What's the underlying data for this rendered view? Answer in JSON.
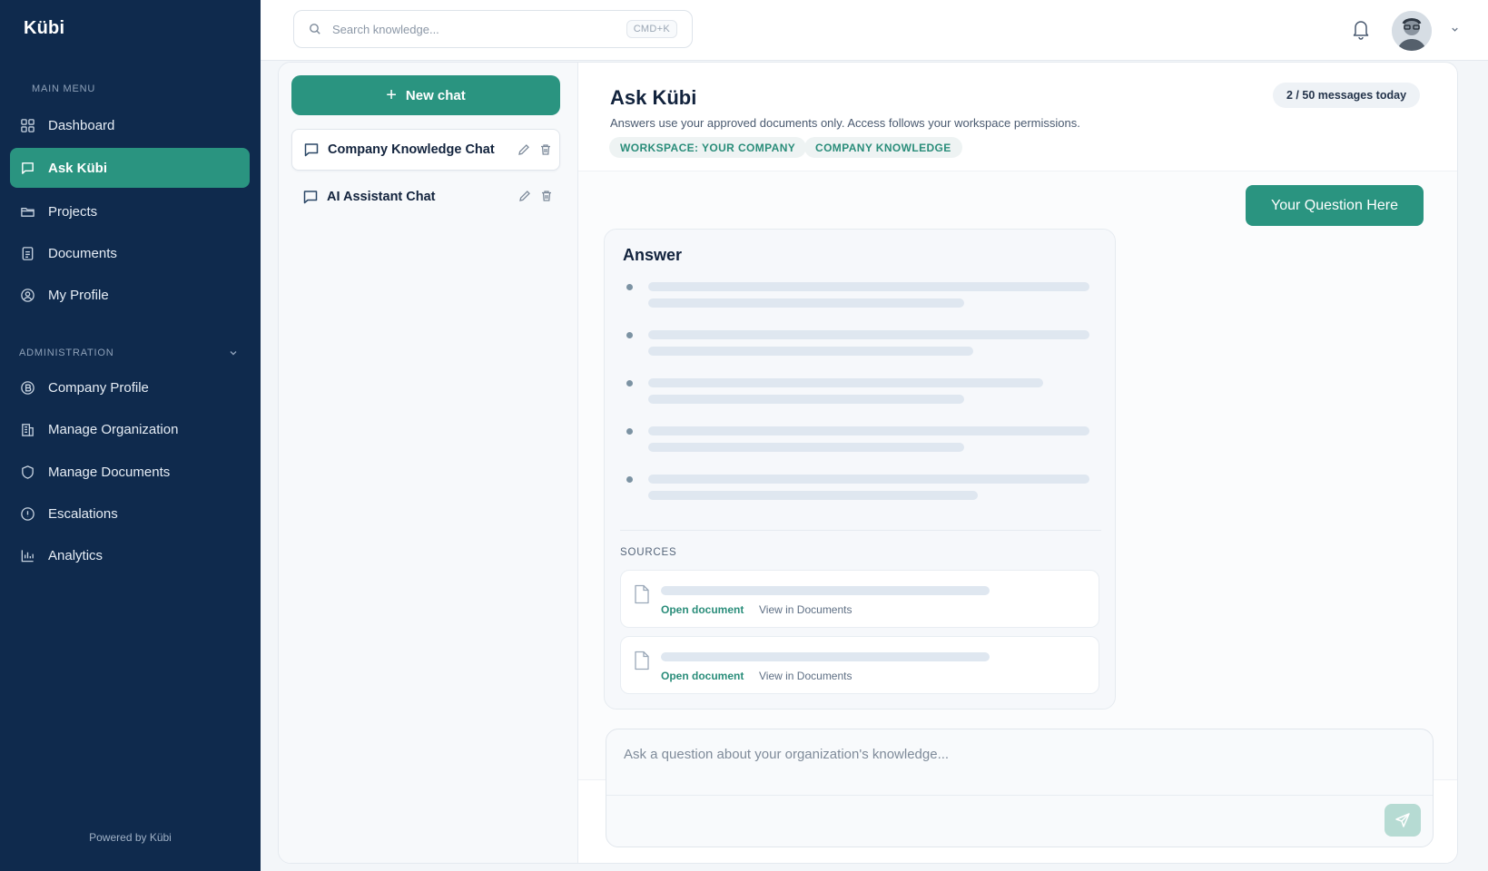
{
  "brand": {
    "name": "Kübi",
    "powered_by": "Powered by Kübi"
  },
  "sidebar": {
    "main_menu_label": "MAIN MENU",
    "admin_label": "ADMINISTRATION",
    "main_items": [
      {
        "label": "Dashboard",
        "icon": "dashboard-icon"
      },
      {
        "label": "Ask Kübi",
        "icon": "chat-icon",
        "active": true
      },
      {
        "label": "Projects",
        "icon": "folder-icon"
      },
      {
        "label": "Documents",
        "icon": "document-icon"
      },
      {
        "label": "My Profile",
        "icon": "profile-icon"
      }
    ],
    "admin_items": [
      {
        "label": "Company Profile",
        "icon": "company-icon"
      },
      {
        "label": "Manage Organization",
        "icon": "building-icon"
      },
      {
        "label": "Manage Documents",
        "icon": "shield-icon"
      },
      {
        "label": "Escalations",
        "icon": "alert-icon"
      },
      {
        "label": "Analytics",
        "icon": "analytics-icon"
      }
    ]
  },
  "topbar": {
    "search_placeholder": "Search knowledge...",
    "shortcut": "CMD+K"
  },
  "chats": {
    "new_chat_label": "New chat",
    "items": [
      {
        "title": "Company Knowledge Chat",
        "selected": true
      },
      {
        "title": "AI Assistant Chat",
        "selected": false
      }
    ]
  },
  "conversation": {
    "title": "Ask Kübi",
    "subtitle": "Answers use your approved documents only. Access follows your workspace permissions.",
    "tags": [
      "WORKSPACE: YOUR COMPANY",
      "COMPANY KNOWLEDGE"
    ],
    "quota": "2 / 50 messages today",
    "question": "Your Question Here",
    "answer_title": "Answer",
    "sources_label": "SOURCES",
    "sources": [
      {
        "open": "Open document",
        "view": "View in Documents"
      },
      {
        "open": "Open document",
        "view": "View in Documents"
      }
    ],
    "composer_placeholder": "Ask a question about your organization's knowledge..."
  },
  "colors": {
    "sidebar": "#0f2a4d",
    "accent": "#2a9480",
    "accent_light": "#b6dbd3"
  }
}
